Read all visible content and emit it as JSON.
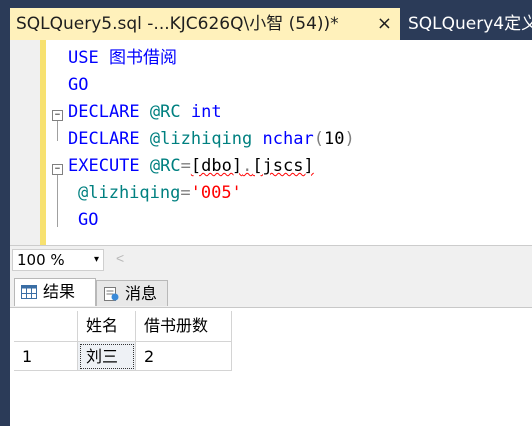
{
  "tabs": {
    "active": {
      "title": "SQLQuery5.sql -...KJC626Q\\小智 (54))*",
      "close": "×"
    },
    "inactive": {
      "title": "SQLQuery4定义"
    }
  },
  "editor": {
    "line1": {
      "kw": "USE",
      "ident": "图书借阅"
    },
    "line2": {
      "kw": "GO"
    },
    "line3": {
      "kw": "DECLARE",
      "var": "@RC",
      "type": "int"
    },
    "line4": {
      "kw": "DECLARE",
      "var": "@lizhiqing",
      "type": "nchar",
      "paren_open": "(",
      "num": "10",
      "paren_close": ")"
    },
    "line5": {
      "kw": "EXECUTE",
      "var": "@RC",
      "eq": "=",
      "schema": "[dbo]",
      "dot": ".",
      "proc": "[jscs]"
    },
    "line6": {
      "var": "@lizhiqing",
      "eq": "=",
      "str": "'005'"
    },
    "line7": {
      "kw": "GO"
    },
    "fold_sign": "−"
  },
  "zoom": {
    "value": "100 %",
    "arrow": "▾",
    "scroll_left": "<"
  },
  "result_tabs": {
    "results": "结果",
    "messages": "消息"
  },
  "grid": {
    "columns": [
      "姓名",
      "借书册数"
    ],
    "rows": [
      {
        "row_number": "1",
        "cells": [
          "刘三",
          "2"
        ]
      }
    ]
  },
  "colors": {
    "keyword": "#0000ff",
    "string": "#ff0000",
    "tab_active": "#fff1bb",
    "chrome": "#2b3b58"
  }
}
